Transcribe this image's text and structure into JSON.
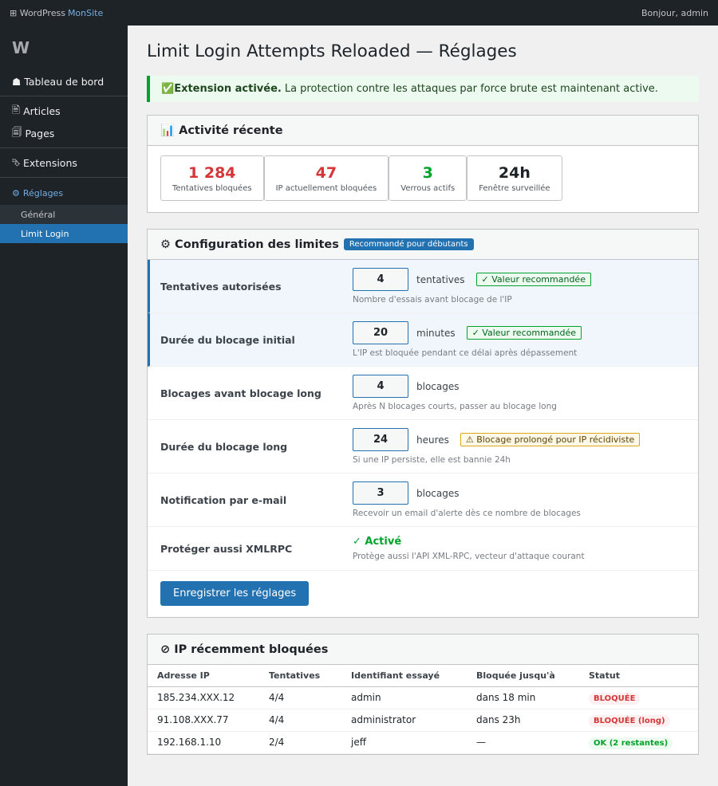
{
  "topbar": {
    "site_prefix": "⊞ WordPress",
    "site_accent": "MonSite",
    "greeting": "Bonjour, admin"
  },
  "sidebar": {
    "logo": "W",
    "items": [
      {
        "icon": "☗",
        "label": "Tableau de bord"
      },
      {
        "icon": "🖹",
        "label": "Articles"
      },
      {
        "icon": "🗐",
        "label": "Pages"
      },
      {
        "icon": "⮷",
        "label": "Extensions"
      },
      {
        "icon": "⚙",
        "label": "Réglages"
      }
    ],
    "submenu": [
      "Général",
      "Limit Login"
    ]
  },
  "page": {
    "title": "Limit Login Attempts Reloaded — Réglages",
    "notice_icon": "✅",
    "notice_bold": "Extension activée.",
    "notice_text": "La protection contre les attaques par force brute est maintenant active."
  },
  "activity": {
    "title": "📊 Activité récente",
    "stats": [
      {
        "value": "1 284",
        "label": "Tentatives bloquées",
        "color": "#d63638"
      },
      {
        "value": "47",
        "label": "IP actuellement bloquées",
        "color": "#d63638"
      },
      {
        "value": "3",
        "label": "Verrous actifs",
        "color": "#00a32a"
      },
      {
        "value": "24h",
        "label": "Fenêtre surveillée",
        "color": "#1d2327"
      }
    ]
  },
  "config": {
    "title": "⚙ Configuration des limites",
    "pill": "Recommandé pour débutants",
    "rows": [
      {
        "label": "Tentatives autorisées",
        "value": "4",
        "unit": "tentatives",
        "tag": "✓ Valeur recommandée",
        "hint": "Nombre d'essais avant blocage de l'IP"
      },
      {
        "label": "Durée du blocage initial",
        "value": "20",
        "unit": "minutes",
        "tag": "✓ Valeur recommandée",
        "hint": "L'IP est bloquée pendant ce délai après dépassement"
      },
      {
        "label": "Blocages avant blocage long",
        "value": "4",
        "unit": "blocages",
        "hint": "Après N blocages courts, passer au blocage long"
      },
      {
        "label": "Durée du blocage long",
        "value": "24",
        "unit": "heures",
        "tag": "⚠ Blocage prolongé pour IP récidiviste",
        "hint": "Si une IP persiste, elle est bannie 24h"
      },
      {
        "label": "Notification par e-mail",
        "value": "3",
        "unit": "blocages",
        "hint": "Recevoir un email d'alerte dès ce nombre de blocages"
      },
      {
        "label": "Protéger aussi XMLRPC",
        "status": "✓ Activé",
        "hint": "Protège aussi l'API XML-RPC, vecteur d'attaque courant"
      }
    ],
    "save_label": "Enregistrer les réglages"
  },
  "blocked": {
    "title": "⊘ IP récemment bloquées",
    "columns": [
      "Adresse IP",
      "Tentatives",
      "Identifiant essayé",
      "Bloquée jusqu'à",
      "Statut"
    ],
    "rows": [
      {
        "ip": "185.234.XXX.12",
        "attempts": "4/4",
        "user": "admin",
        "until": "dans 18 min",
        "status": "BLOQUÉE"
      },
      {
        "ip": "91.108.XXX.77",
        "attempts": "4/4",
        "user": "administrator",
        "until": "dans 23h",
        "status": "BLOQUÉE (long)"
      },
      {
        "ip": "192.168.1.10",
        "attempts": "2/4",
        "user": "jeff",
        "until": "—",
        "status": "OK (2 restantes)"
      }
    ]
  }
}
